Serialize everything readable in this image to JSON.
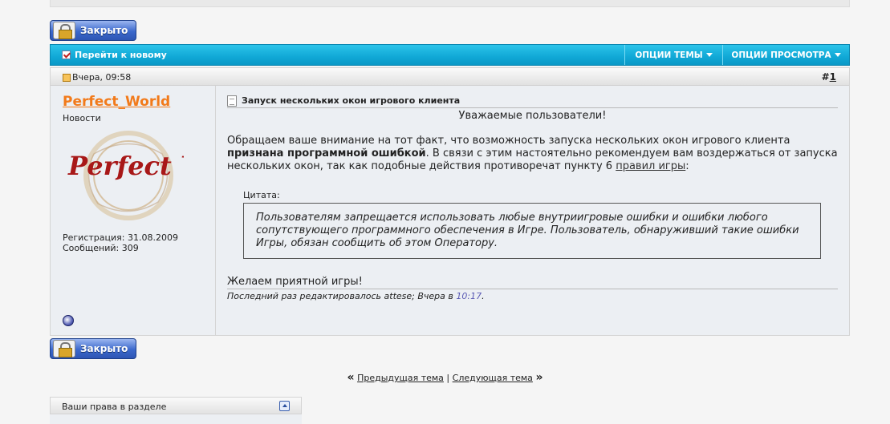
{
  "buttons": {
    "closed_label": "Закрыто"
  },
  "navbar": {
    "goto_new": "Перейти к новому",
    "thread_options": "ОПЦИИ ТЕМЫ",
    "view_options": "ОПЦИИ ПРОСМОТРА"
  },
  "post": {
    "date": "Вчера, 09:58",
    "number_prefix": "#",
    "number": "1",
    "user": {
      "name": "Perfect_World",
      "title": "Новости",
      "avatar_text": "Perfect World",
      "registration": "Регистрация: 31.08.2009",
      "posts": "Сообщений: 309"
    },
    "title": "Запуск нескольких окон игрового клиента",
    "greeting": "Уважаемые пользователи!",
    "body_part1": "Обращаем ваше внимание на тот факт, что возможность запуска нескольких окон игрового клиента ",
    "body_bold": "признана программной ошибкой",
    "body_part2": ". В связи с этим настоятельно рекомендуем вам воздержаться от запуска нескольких окон, так как подобные действия противоречат пункту 6 ",
    "body_link": "правил игры",
    "body_end": ":",
    "quote_label": "Цитата:",
    "quote_text": "Пользователям запрещается использовать любые внутриигровые ошибки и ошибки любого сопутствующего программного обеспечения в Игре. Пользователь, обнаруживший такие ошибки Игры, обязан сообщить об этом Оператору.",
    "wish": "Желаем приятной игры!",
    "edited_prefix": "Последний раз редактировалось attese; Вчера в ",
    "edited_time": "10:17",
    "edited_suffix": "."
  },
  "thread_nav": {
    "left_quote": "«",
    "prev": "Предыдущая тема",
    "sep": "|",
    "next": "Следующая тема",
    "right_quote": "»"
  },
  "rights": {
    "label": "Ваши права в разделе"
  },
  "icons": {
    "lock": "lock-icon",
    "checkbox": "checkbox-icon",
    "dropdown": "triangle-down-icon",
    "post": "post-icon",
    "document": "document-icon",
    "online": "online-status-icon",
    "collapse": "collapse-icon"
  },
  "colors": {
    "navbar": "#10a8d6",
    "username": "#f27a1a",
    "button": "#3b68cc",
    "time_link": "#5a5ab4"
  }
}
